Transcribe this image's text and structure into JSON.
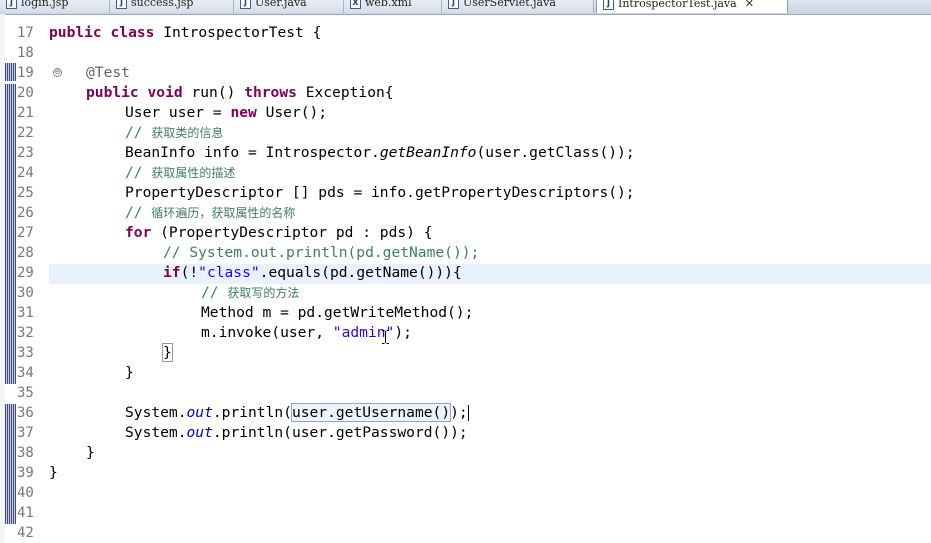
{
  "tabs": [
    {
      "icon": "J",
      "label": "login.jsp",
      "active": false
    },
    {
      "icon": "J",
      "label": "success.jsp",
      "active": false
    },
    {
      "icon": "J",
      "label": "User.java",
      "active": false
    },
    {
      "icon": "X",
      "label": "web.xml",
      "active": false
    },
    {
      "icon": "J",
      "label": "UserServlet.java",
      "active": false
    },
    {
      "icon": "J",
      "label": "IntrospectorTest.java",
      "active": true,
      "close": "✕"
    }
  ],
  "editor": {
    "line_numbers": [
      "17",
      "18",
      "19",
      "20",
      "21",
      "22",
      "23",
      "24",
      "25",
      "26",
      "27",
      "28",
      "29",
      "30",
      "31",
      "32",
      "33",
      "34",
      "35",
      "36",
      "37",
      "38",
      "39",
      "40",
      "41",
      "42"
    ],
    "fold_marker": "⊖",
    "code": {
      "l17": {
        "kw1": "public",
        "kw2": "class",
        "rest": " IntrospectorTest {"
      },
      "l19": {
        "ann": "@Test"
      },
      "l20": {
        "kw1": "public",
        "kw2": "void",
        "mid": " run() ",
        "kw3": "throws",
        "rest": " Exception{"
      },
      "l21": {
        "pre": "User user = ",
        "kw": "new",
        "rest": " User();"
      },
      "l22": {
        "slashes": "// ",
        "text": "获取类的信息"
      },
      "l23": {
        "pre": "BeanInfo info = Introspector.",
        "it": "getBeanInfo",
        "rest": "(user.getClass());"
      },
      "l24": {
        "slashes": "// ",
        "text": "获取属性的描述"
      },
      "l25": {
        "text": "PropertyDescriptor [] pds = info.getPropertyDescriptors();"
      },
      "l26": {
        "slashes": "// ",
        "text": "循环遍历，获取属性的名称"
      },
      "l27": {
        "kw": "for",
        "rest": " (PropertyDescriptor pd : pds) {"
      },
      "l28": {
        "text": "// System.out.println(pd.getName());"
      },
      "l29": {
        "kw": "if",
        "p1": "(!",
        "str": "\"class\"",
        "rest": ".equals(pd.getName())){"
      },
      "l30": {
        "slashes": "// ",
        "text": "获取写的方法"
      },
      "l31": {
        "text": "Method m = pd.getWriteMethod();"
      },
      "l32": {
        "pre": "m.invoke(user, ",
        "str": "\"admin\"",
        "rest": ");"
      },
      "l33": {
        "text": "}"
      },
      "l34": {
        "text": "}"
      },
      "l36": {
        "pre": "System.",
        "fld": "out",
        "mid": ".println(",
        "occ": "user.getUsername()",
        "rest": ");"
      },
      "l37": {
        "pre": "System.",
        "fld": "out",
        "rest": ".println(user.getPassword());"
      },
      "l38": {
        "text": "}"
      },
      "l39": {
        "text": "}"
      }
    }
  }
}
